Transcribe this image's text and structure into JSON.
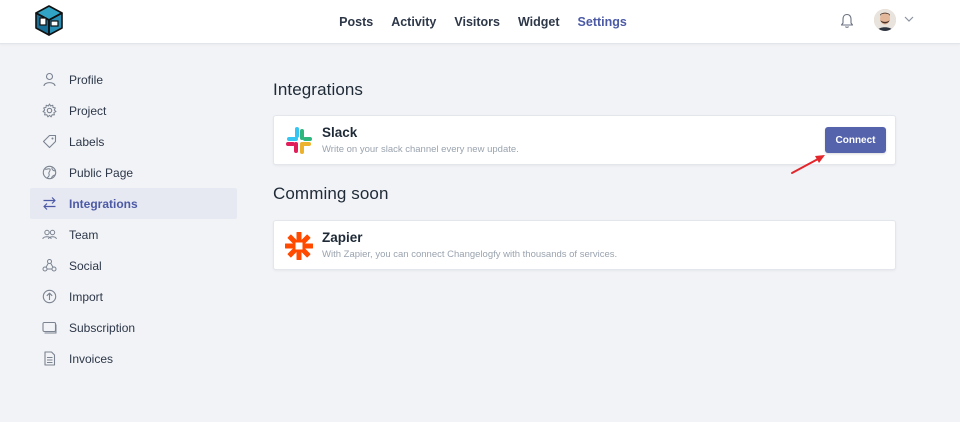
{
  "header": {
    "nav": [
      {
        "label": "Posts",
        "name": "nav-posts",
        "active": false
      },
      {
        "label": "Activity",
        "name": "nav-activity",
        "active": false
      },
      {
        "label": "Visitors",
        "name": "nav-visitors",
        "active": false
      },
      {
        "label": "Widget",
        "name": "nav-widget",
        "active": false
      },
      {
        "label": "Settings",
        "name": "nav-settings",
        "active": true
      }
    ]
  },
  "sidebar": {
    "items": [
      {
        "label": "Profile",
        "icon": "user-icon"
      },
      {
        "label": "Project",
        "icon": "gear-icon"
      },
      {
        "label": "Labels",
        "icon": "tag-icon"
      },
      {
        "label": "Public Page",
        "icon": "globe-icon"
      },
      {
        "label": "Integrations",
        "icon": "arrows-swap-icon",
        "active": true
      },
      {
        "label": "Team",
        "icon": "team-icon"
      },
      {
        "label": "Social",
        "icon": "share-icon"
      },
      {
        "label": "Import",
        "icon": "upload-icon"
      },
      {
        "label": "Subscription",
        "icon": "card-icon"
      },
      {
        "label": "Invoices",
        "icon": "document-icon"
      }
    ]
  },
  "main": {
    "integrations_title": "Integrations",
    "slack": {
      "name": "Slack",
      "description": "Write on your slack channel every new update.",
      "button_label": "Connect"
    },
    "coming_soon_title": "Comming soon",
    "zapier": {
      "name": "Zapier",
      "description": "With Zapier, you can connect Changelogfy with thousands of services."
    }
  },
  "colors": {
    "accent": "#4c5aa6",
    "button": "#5563ad",
    "background": "#f1f3f7",
    "zapier": "#ff4a00",
    "annotation_arrow": "#e3262b"
  }
}
